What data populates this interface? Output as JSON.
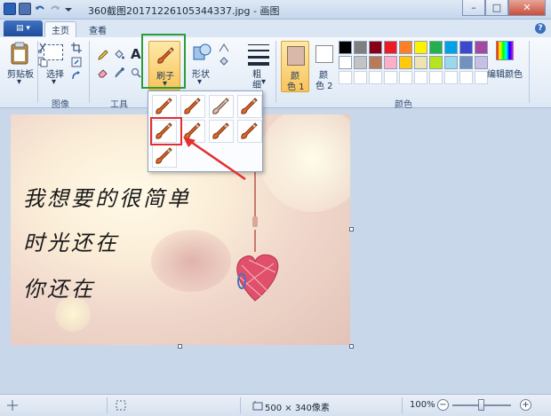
{
  "window": {
    "title": "360截图20171226105344337.jpg - 画图",
    "minimize": "–",
    "maximize": "□",
    "close": "✕"
  },
  "tabs": {
    "home": "主页",
    "view": "查看"
  },
  "ribbon": {
    "clipboard": "剪贴板",
    "select": "选择",
    "image_group": "图像",
    "tools_group": "工具",
    "text_tool": "A",
    "brushes": "刷子",
    "shapes": "形状",
    "stroke_line1": "粗",
    "stroke_line2": "细",
    "color1_line1": "颜",
    "color1_line2": "色 1",
    "color2_line1": "颜",
    "color2_line2": "色 2",
    "colors_group": "颜色",
    "edit_colors": "编辑颜色",
    "palette_row1": [
      "#000000",
      "#7f7f7f",
      "#880015",
      "#ed1c24",
      "#ff7f27",
      "#fff200",
      "#22b14c",
      "#00a2e8",
      "#3f48cc",
      "#a349a4"
    ],
    "palette_row2": [
      "#ffffff",
      "#c3c3c3",
      "#b97a57",
      "#ffaec9",
      "#ffc90e",
      "#efe4b0",
      "#b5e61d",
      "#99d9ea",
      "#7092be",
      "#c8bfe7"
    ],
    "color1_value": "#d9b8aa",
    "accent_green": "#2e9b3b",
    "accent_red": "#e23030"
  },
  "canvas_image": {
    "line1": "我想要的很简单",
    "line2": "时光还在",
    "line3": "你还在"
  },
  "statusbar": {
    "image_size": "500 × 340像素",
    "zoom": "100%",
    "zoom_minus": "−",
    "zoom_plus": "+"
  }
}
